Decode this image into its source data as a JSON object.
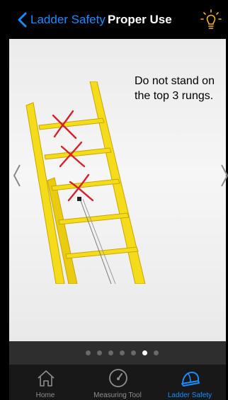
{
  "nav": {
    "back_label": "Ladder Safety",
    "title": "Proper Use"
  },
  "content": {
    "caption": "Do not stand on the top 3 rungs."
  },
  "pager": {
    "count": 7,
    "current": 6
  },
  "tabs": [
    {
      "label": "Home",
      "icon": "home-icon",
      "selected": false
    },
    {
      "label": "Measuring Tool",
      "icon": "gauge-icon",
      "selected": false
    },
    {
      "label": "Ladder Safety",
      "icon": "hard-hat-icon",
      "selected": true
    }
  ],
  "colors": {
    "accent": "#1a8cff",
    "ladder": "#f5dc1a",
    "x_mark": "#d4202f"
  }
}
